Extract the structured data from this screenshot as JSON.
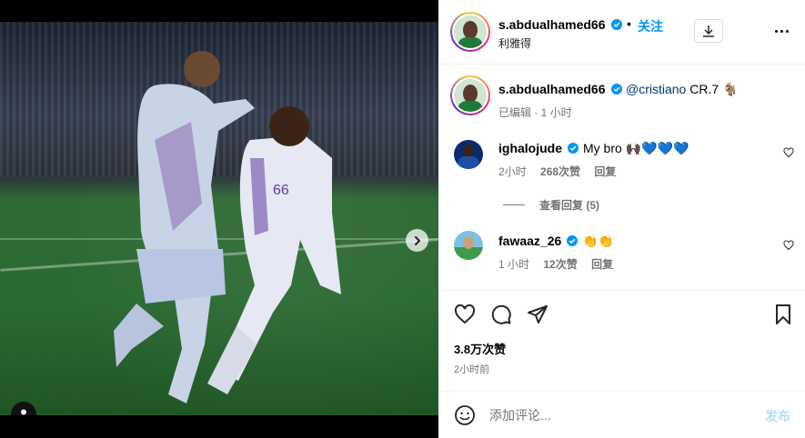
{
  "post": {
    "carousel": {
      "slide_count": 4,
      "active_slide": 1
    }
  },
  "header": {
    "username": "s.abdualhamed66",
    "separator": "•",
    "follow_label": "关注",
    "location": "利雅得"
  },
  "caption": {
    "username": "s.abdualhamed66",
    "mention": "@cristiano",
    "text": " CR.7",
    "emoji": "🐐",
    "meta_time": "已编辑 · 1 小时"
  },
  "comments": [
    {
      "username": "ighalojude",
      "text": "My bro ",
      "emoji": "🙌🏿💙💙💙",
      "time": "2小时",
      "likes": "268次赞",
      "reply_label": "回复"
    },
    {
      "username": "fawaaz_26",
      "text": "",
      "emoji": "👏👏",
      "time": "1 小时",
      "likes": "12次赞",
      "reply_label": "回复"
    }
  ],
  "view_replies_label": "查看回复 (5)",
  "stats": {
    "likes": "3.8万次赞",
    "time_ago": "2小时前"
  },
  "comment_box": {
    "placeholder": "添加评论...",
    "post_label": "发布"
  },
  "colors": {
    "accent": "#0095f6",
    "post_disabled": "#b2dffc",
    "verified": "#0095f6",
    "muted": "#737373"
  }
}
